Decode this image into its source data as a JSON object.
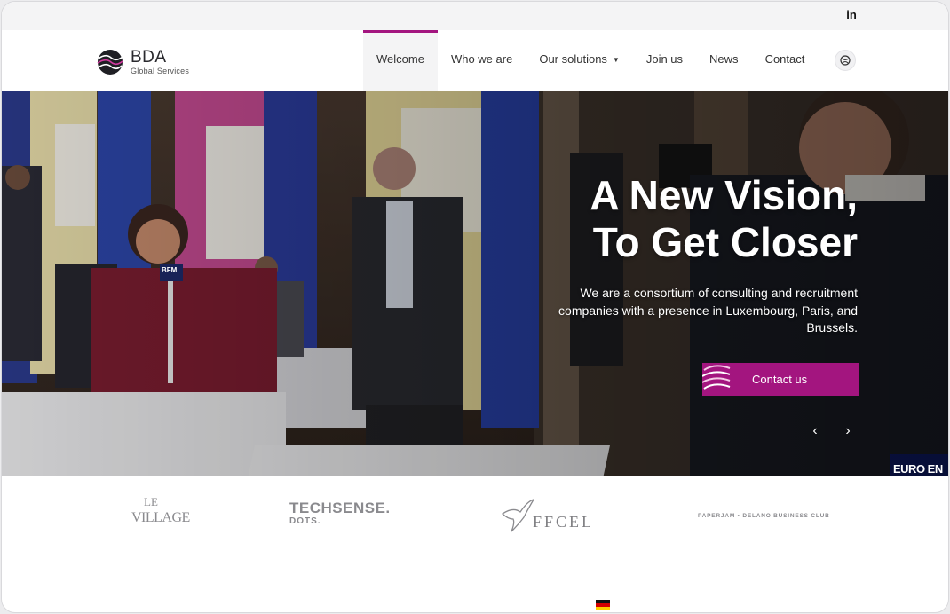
{
  "topbar": {
    "linkedin_label": "in"
  },
  "brand": {
    "name": "BDA",
    "tagline": "Global Services",
    "accent": "#a3157f"
  },
  "nav": {
    "items": [
      {
        "label": "Welcome",
        "active": true
      },
      {
        "label": "Who we are"
      },
      {
        "label": "Our solutions",
        "has_dropdown": true
      },
      {
        "label": "Join us"
      },
      {
        "label": "News"
      },
      {
        "label": "Contact"
      }
    ],
    "dropdown_caret": "▼",
    "language_icon": "globe-icon"
  },
  "hero": {
    "title": "A New Vision,\nTo Get Closer",
    "subtitle": "We are a consortium of consulting and recruitment companies with a presence in Luxembourg, Paris, and Brussels.",
    "cta_label": "Contact us",
    "prev_icon": "‹",
    "next_icon": "›",
    "mic_label": "BFM",
    "corner_text": "EURO EN"
  },
  "partners": {
    "village": {
      "line1": "LE",
      "line2": "VILLAGE"
    },
    "techsense": {
      "name": "TECHSENSE.",
      "sub": "DOTS."
    },
    "ffcel": "FFCEL",
    "paperjam": "PAPERJAM • DELANO BUSINESS CLUB"
  },
  "language": {
    "flag": "de-flag"
  }
}
